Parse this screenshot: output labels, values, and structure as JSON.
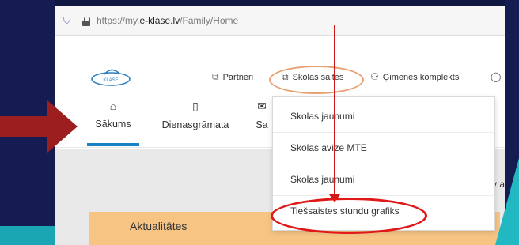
{
  "browser": {
    "url_prefix": "https://my.",
    "url_domain": "e-klase.lv",
    "url_path": "/Family/Home"
  },
  "logo": {
    "text": "KLASE"
  },
  "topnav": {
    "items": [
      {
        "label": "Partneri",
        "icon": "external-link-icon"
      },
      {
        "label": "Skolas saites",
        "icon": "external-link-icon"
      },
      {
        "label": "Ģimenes komplekts",
        "icon": "family-icon"
      }
    ]
  },
  "tabs": [
    {
      "label": "Sākums",
      "icon": "home-icon",
      "active": true
    },
    {
      "label": "Dienasgrāmata",
      "icon": "book-icon",
      "active": false
    },
    {
      "label": "Sa",
      "icon": "mail-icon",
      "active": false
    }
  ],
  "dropdown": {
    "items": [
      {
        "label": "Skolas jaunumi"
      },
      {
        "label": "Skolas avīze MTE"
      },
      {
        "label": "Skolas jaunumi"
      },
      {
        "label": "Tiešsaistes stundu grafiks"
      }
    ]
  },
  "content": {
    "card_title": "Aktualitātes",
    "side_fragment": "v a"
  },
  "colors": {
    "background": "#12194a",
    "accent": "#1b83c4",
    "card": "#f7c484",
    "highlight_red": "#e01818",
    "highlight_orange": "#e8a070"
  }
}
